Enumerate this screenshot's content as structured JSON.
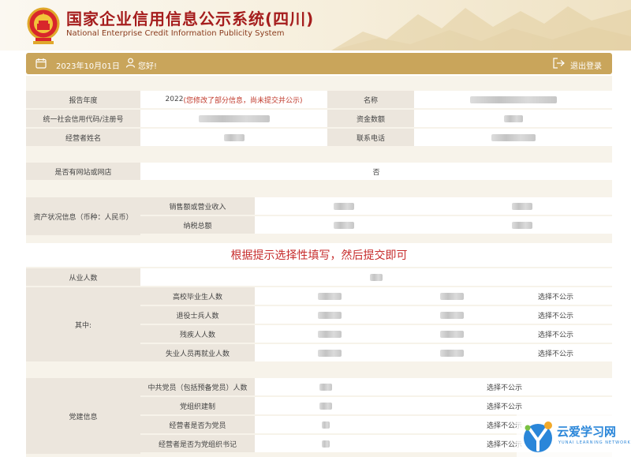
{
  "header": {
    "title_cn": "国家企业信用信息公示系统(四川)",
    "title_en": "National Enterprise Credit Information Publicity System"
  },
  "bar": {
    "date": "2023年10月01日",
    "greeting": "您好!",
    "logout": "退出登录"
  },
  "basic": {
    "report_year_label": "报告年度",
    "report_year_value": "2022",
    "report_year_note": "(您修改了部分信息，尚未提交并公示)",
    "name_label": "名称",
    "credit_code_label": "统一社会信用代码/注册号",
    "capital_label": "资金数额",
    "operator_label": "经营者姓名",
    "phone_label": "联系电话"
  },
  "website": {
    "label": "是否有网站或网店",
    "value": "否"
  },
  "assets": {
    "group_label": "资产状况信息（币种：人民币）",
    "rows": [
      "销售额或营业收入",
      "纳税总额"
    ]
  },
  "notice": "根据提示选择性填写，然后提交即可",
  "employees": {
    "label": "从业人数",
    "sub_label": "其中:",
    "rows": [
      "高校毕业生人数",
      "退役士兵人数",
      "残疾人人数",
      "失业人员再就业人数"
    ],
    "status": "选择不公示"
  },
  "party": {
    "group_label": "党建信息",
    "rows": [
      "中共党员（包括预备党员）人数",
      "党组织建制",
      "经营者是否为党员",
      "经营者是否为党组织书记"
    ],
    "status": "选择不公示"
  },
  "watermark": {
    "text": "云爱学习网",
    "sub": "YUNAI LEARNING NETWORK"
  }
}
